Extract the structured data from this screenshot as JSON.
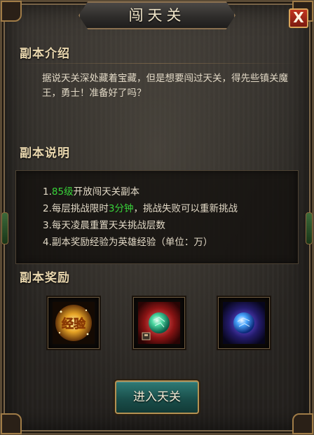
{
  "window": {
    "title": "闯天关",
    "close_label": "X"
  },
  "sections": {
    "intro": {
      "title": "副本介绍",
      "text": "据说天关深处藏着宝藏，但是想要闯过天关，得先些镇关魔王，勇士！准备好了吗？"
    },
    "rules": {
      "title": "副本说明",
      "items": [
        {
          "num": "1.",
          "highlight": "85级",
          "text": "开放闯天关副本"
        },
        {
          "num": "2.",
          "pre": "每层挑战限时",
          "highlight": "3分钟",
          "text": "，挑战失败可以重新挑战"
        },
        {
          "num": "3.",
          "text": "每天凌晨重置天关挑战层数"
        },
        {
          "num": "4.",
          "text": "副本奖励经验为英雄经验（单位：万）"
        }
      ]
    },
    "rewards": {
      "title": "副本奖励",
      "items": [
        {
          "name": "经验",
          "icon": "exp-scroll-icon"
        },
        {
          "icon": "green-orb-icon"
        },
        {
          "icon": "blue-orb-icon"
        }
      ]
    }
  },
  "actions": {
    "enter_label": "进入天关"
  },
  "colors": {
    "highlight": "#39d43a",
    "title": "#efe4c8",
    "button": "#1f5c57",
    "close": "#b32c1b"
  }
}
